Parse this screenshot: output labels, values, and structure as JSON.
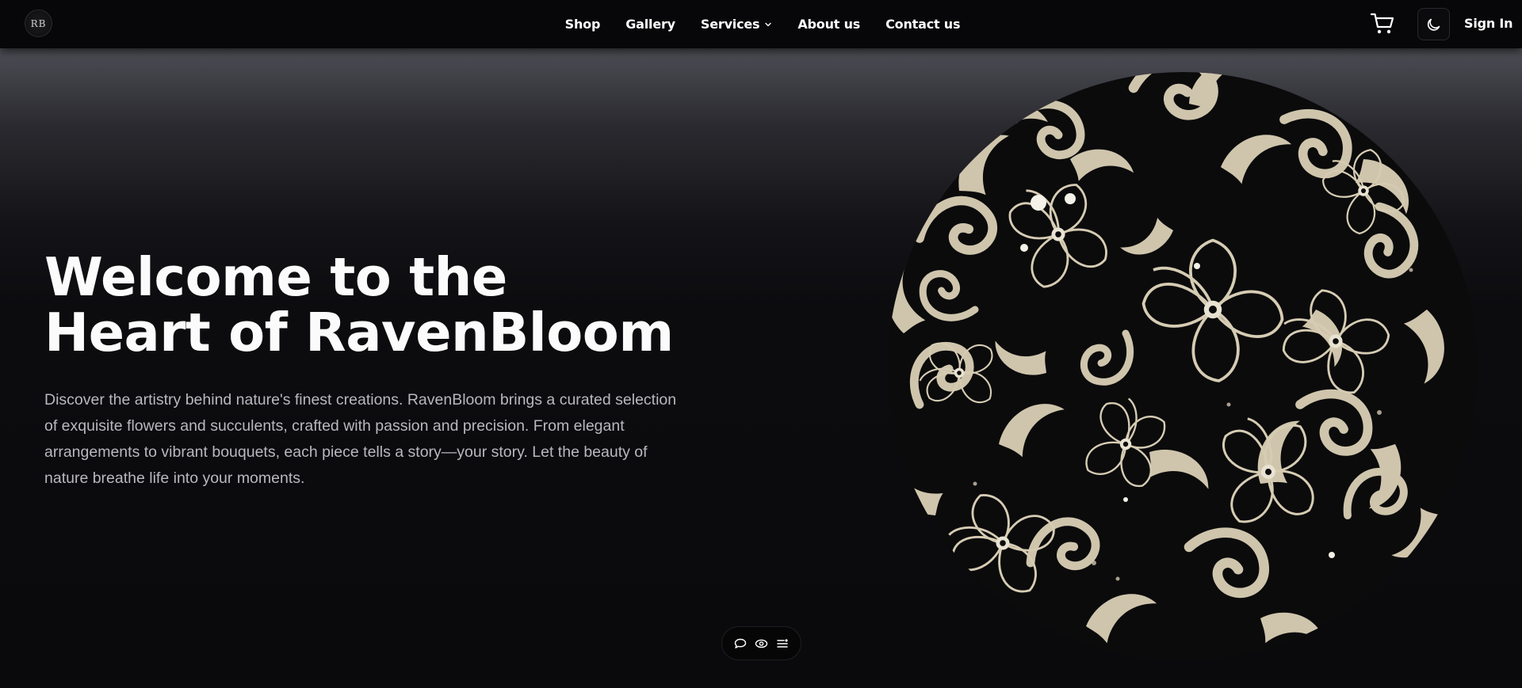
{
  "brand": {
    "logo_text": "RB",
    "logo_icon": "raven-bloom-monogram-icon"
  },
  "nav": {
    "links": [
      {
        "label": "Shop"
      },
      {
        "label": "Gallery"
      },
      {
        "label": "Services",
        "has_dropdown": true
      },
      {
        "label": "About us"
      },
      {
        "label": "Contact us"
      }
    ],
    "cart_icon": "cart-icon",
    "theme_icon": "moon-icon",
    "signin_label": "Sign In"
  },
  "hero": {
    "title_line1": "Welcome to the",
    "title_line2": "Heart of RavenBloom",
    "description": "Discover the artistry behind nature's finest creations. RavenBloom brings a curated selection of exquisite flowers and succulents, crafted with passion and precision. From elegant arrangements to vibrant bouquets, each piece tells a story—your story. Let the beauty of nature breathe life into your moments.",
    "image_alt": "floral-orb-illustration"
  },
  "floating_toolbar": {
    "icons": [
      "comment-icon",
      "eye-icon",
      "menu-list-icon"
    ]
  },
  "colors": {
    "background": "#0a0a0c",
    "nav_background": "#070709",
    "text_primary": "#ffffff",
    "text_secondary": "#b8b8be",
    "floral_cream": "#cfc5ac",
    "floral_white": "#f3f0e6"
  }
}
